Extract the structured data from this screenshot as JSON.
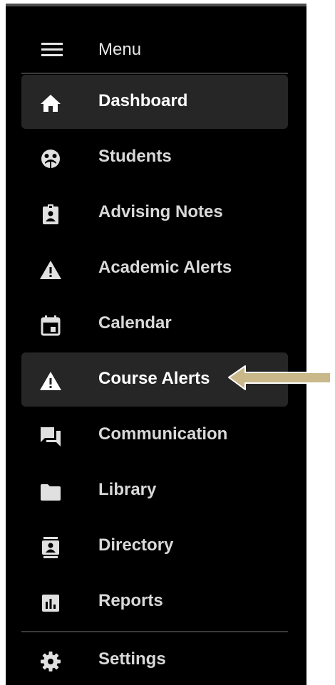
{
  "menu": {
    "label": "Menu",
    "icon": "hamburger-icon"
  },
  "nav": {
    "items": [
      {
        "label": "Dashboard",
        "icon": "home-icon",
        "active": true
      },
      {
        "label": "Students",
        "icon": "students-icon",
        "active": false
      },
      {
        "label": "Advising Notes",
        "icon": "advising-notes-icon",
        "active": false
      },
      {
        "label": "Academic Alerts",
        "icon": "warning-icon",
        "active": false
      },
      {
        "label": "Calendar",
        "icon": "calendar-icon",
        "active": false
      },
      {
        "label": "Course Alerts",
        "icon": "warning-icon",
        "active": true
      },
      {
        "label": "Communication",
        "icon": "chat-icon",
        "active": false
      },
      {
        "label": "Library",
        "icon": "folder-icon",
        "active": false
      },
      {
        "label": "Directory",
        "icon": "contact-card-icon",
        "active": false
      },
      {
        "label": "Reports",
        "icon": "bar-chart-icon",
        "active": false
      }
    ]
  },
  "settings": {
    "label": "Settings",
    "icon": "gear-icon"
  },
  "colors": {
    "sidebar_bg": "#000000",
    "active_bg": "#262626",
    "text": "#d9d9d9",
    "arrow": "#c8b88a"
  }
}
